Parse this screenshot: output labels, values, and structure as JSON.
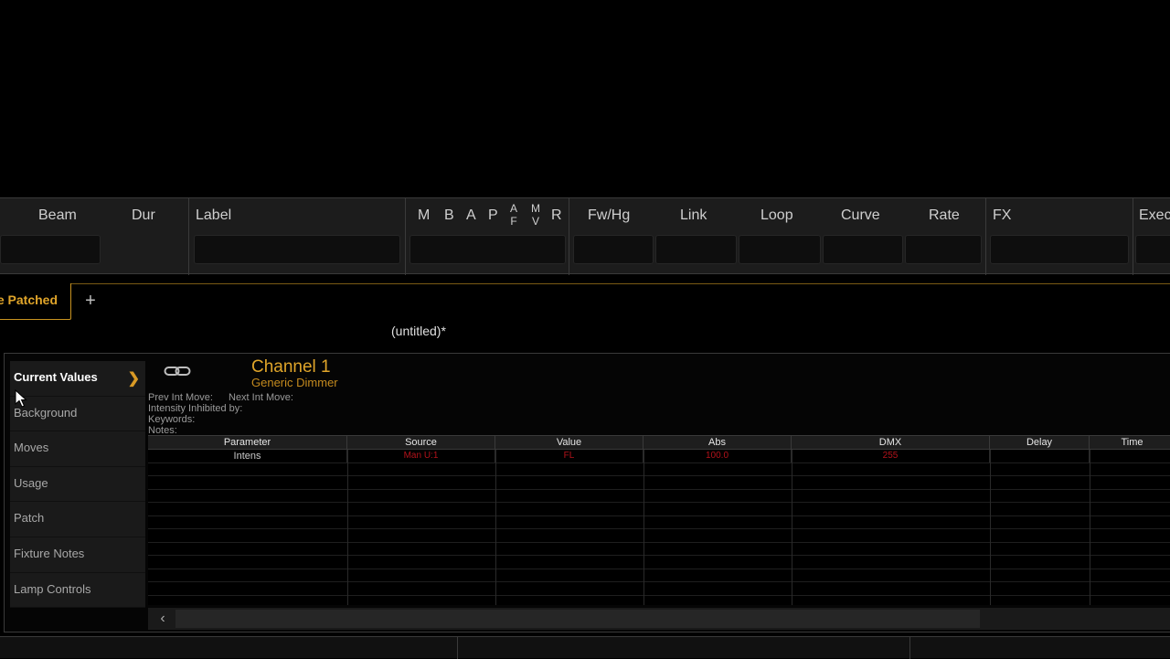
{
  "cue_columns": {
    "beam": "Beam",
    "dur": "Dur",
    "label": "Label",
    "m": "M",
    "b": "B",
    "a": "A",
    "p": "P",
    "af_a": "A",
    "af_f": "F",
    "mv_m": "M",
    "mv_v": "V",
    "r": "R",
    "fwhg": "Fw/Hg",
    "link": "Link",
    "loop": "Loop",
    "curve": "Curve",
    "rate": "Rate",
    "fx": "FX",
    "exec": "Exec"
  },
  "tabs": {
    "active_label": "e Patched",
    "add_label": "+"
  },
  "document_title": "(untitled)*",
  "side_menu": {
    "items": [
      {
        "label": "Current Values"
      },
      {
        "label": "Background"
      },
      {
        "label": "Moves"
      },
      {
        "label": "Usage"
      },
      {
        "label": "Patch"
      },
      {
        "label": "Fixture Notes"
      },
      {
        "label": "Lamp Controls"
      }
    ],
    "arrow": "❯"
  },
  "channel": {
    "title": "Channel 1",
    "subtitle": "Generic Dimmer"
  },
  "info": {
    "prev_int_move": "Prev Int Move:",
    "next_int_move": "Next Int Move:",
    "intensity_inhibited": "Intensity Inhibited by:",
    "keywords": "Keywords:",
    "notes": "Notes:"
  },
  "table": {
    "headers": [
      "Parameter",
      "Source",
      "Value",
      "Abs",
      "DMX",
      "Delay",
      "Time"
    ],
    "rows": [
      {
        "parameter": "Intens",
        "source": "Man U:1",
        "value": "FL",
        "abs": "100.0",
        "dmx": "255",
        "delay": "",
        "time": ""
      }
    ]
  },
  "colors": {
    "accent": "#e0a52a",
    "red_value": "#b3121a"
  }
}
